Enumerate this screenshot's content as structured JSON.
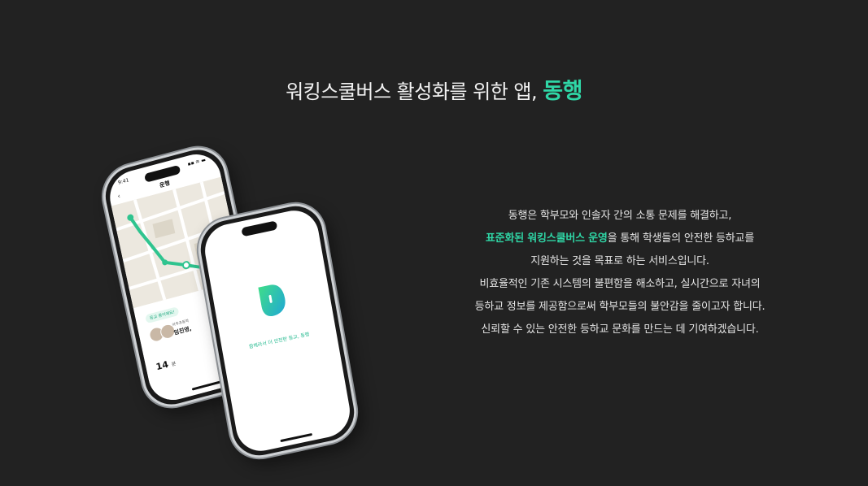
{
  "headline": {
    "prefix": "워킹스쿨버스 활성화를 위한 앱, ",
    "accent": "동행",
    "accent_color": "#2fd6a6"
  },
  "phone_map": {
    "status_time": "9:41",
    "status_icons": "▪▪ ≋ ▬",
    "back_icon": "chevron-left-icon",
    "back_glyph": "‹",
    "title": "운행",
    "route_tag": "등교 중이에요!",
    "leader_sub": "아주초등학",
    "leader_name": "임진영,",
    "count_value": "14",
    "count_unit": "분"
  },
  "phone_splash": {
    "logo": "dongheng-logo",
    "tagline": "함께라서 더 안전한 등교, 동행"
  },
  "description": {
    "line1": "동행은 학부모와 인솔자 간의 소통 문제를 해결하고,",
    "line2_highlight": "표준화된 워킹스쿨버스 운영",
    "line2_rest": "을 통해 학생들의 안전한 등하교를",
    "line3": "지원하는 것을 목표로 하는 서비스입니다.",
    "line4": "비효율적인 기존 시스템의 불편함을 해소하고, 실시간으로 자녀의",
    "line5": "등하교 정보를 제공함으로써 학부모들의 불안감을 줄이고자 합니다.",
    "line6": "신뢰할 수 있는 안전한 등하교 문화를 만드는 데 기여하겠습니다."
  }
}
